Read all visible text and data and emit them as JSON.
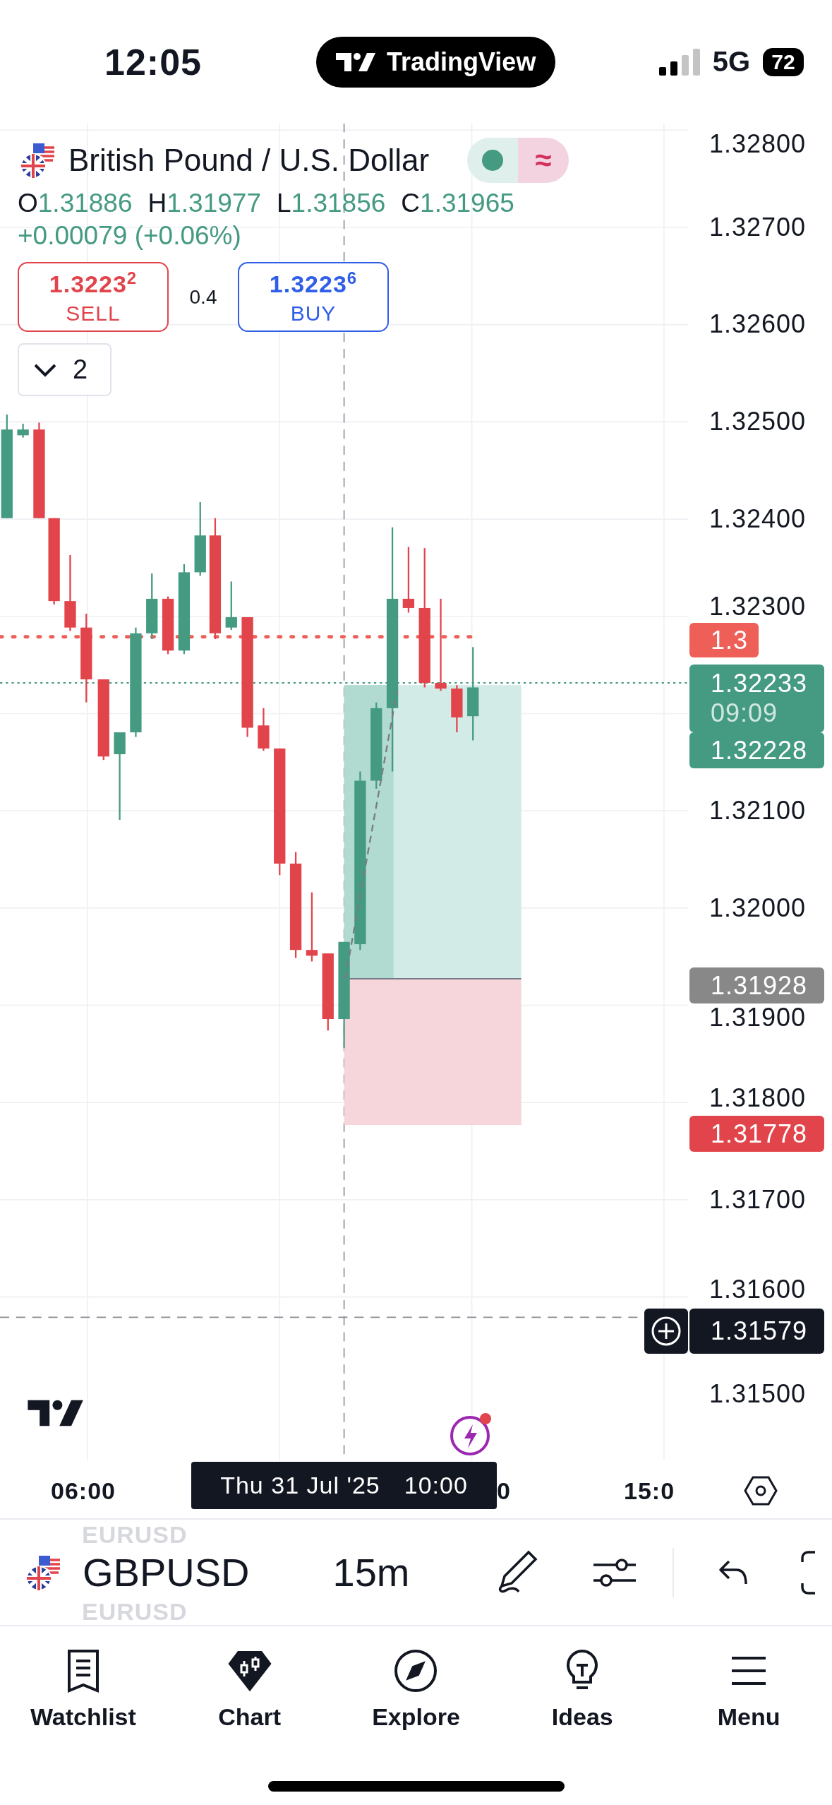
{
  "status_bar": {
    "time": "12:05",
    "app_badge": "TradingView",
    "network": "5G",
    "battery": "72"
  },
  "legend": {
    "title": "British Pound / U.S. Dollar",
    "toggle_symbol": "≈",
    "ohlc": [
      {
        "label": "O",
        "value": "1.31886"
      },
      {
        "label": "H",
        "value": "1.31977"
      },
      {
        "label": "L",
        "value": "1.31856"
      },
      {
        "label": "C",
        "value": "1.31965"
      }
    ],
    "change": "+0.00079 (+0.06%)",
    "sell": {
      "price": "1.3223$^{2}$",
      "label": "SELL"
    },
    "spread": "0.4",
    "buy": {
      "price": "1.3223$^{6}$",
      "label": "BUY"
    },
    "indicators_count": "2"
  },
  "price_axis": {
    "ticks": [
      "1.32800",
      "1.32700",
      "1.32600",
      "1.32500",
      "1.32400",
      "1.32300",
      "1.32100",
      "1.32000",
      "1.31900",
      "1.31800",
      "1.31700",
      "1.31600",
      "1.31500"
    ]
  },
  "price_labels": [
    {
      "kind": "alert",
      "text": "1.3",
      "color": "#ee5f58"
    },
    {
      "kind": "last",
      "text": "1.32233",
      "countdown": "09:09",
      "color": "#459a82"
    },
    {
      "kind": "bid",
      "text": "1.32228",
      "color": "#459a82"
    },
    {
      "kind": "entry",
      "text": "1.31928",
      "color": "#888888"
    },
    {
      "kind": "stop",
      "text": "1.31778",
      "color": "#e2444b"
    },
    {
      "kind": "crosshair",
      "text": "1.31579",
      "color": "#131722"
    }
  ],
  "time_axis": {
    "labels": [
      "06:00",
      "0",
      "15:0"
    ],
    "crosshair_date": "Thu 31 Jul '25",
    "crosshair_time": "10:00"
  },
  "toolbar": {
    "symbol": "GBPUSD",
    "interval": "15m",
    "ghost_symbols": [
      "EURUSD",
      "EURUSD"
    ]
  },
  "tab_bar": [
    {
      "kind": "watchlist",
      "label": "Watchlist",
      "selected": false
    },
    {
      "kind": "chart",
      "label": "Chart",
      "selected": true
    },
    {
      "kind": "explore",
      "label": "Explore",
      "selected": false
    },
    {
      "kind": "ideas",
      "label": "Ideas",
      "selected": false
    },
    {
      "kind": "menu",
      "label": "Menu",
      "selected": false
    }
  ]
}
